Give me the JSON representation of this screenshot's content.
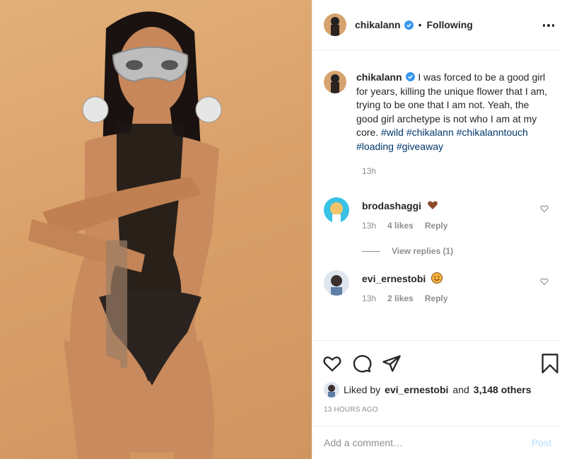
{
  "post": {
    "author": "chikalann",
    "follow_sep": "•",
    "follow_status": "Following",
    "caption_text": "I was forced to be a good girl for years, killing the unique flower that I am, trying to be one that I am not. Yeah, the good girl archetype is not who I am at my core.",
    "hashtags": [
      "#wild",
      "#chikalann",
      "#chikalanntouch",
      "#loading",
      "#giveaway"
    ],
    "caption_time": "13h",
    "comments": [
      {
        "user": "brodashaggi",
        "emoji": "brown-heart",
        "time": "13h",
        "likes": "4 likes",
        "reply": "Reply",
        "view_replies": "View replies (1)"
      },
      {
        "user": "evi_ernestobi",
        "emoji": "smiling-face",
        "time": "13h",
        "likes": "2 likes",
        "reply": "Reply"
      }
    ],
    "liked_by_prefix": "Liked by",
    "liked_by_user": "evi_ernestobi",
    "liked_by_and": "and",
    "liked_by_others": "3,148 others",
    "time_ago": "13 HOURS AGO",
    "add_comment_placeholder": "Add a comment…",
    "post_button": "Post"
  },
  "icons": {
    "more": "more-dots-icon",
    "like": "heart-icon",
    "comment": "comment-bubble-icon",
    "share": "paper-plane-icon",
    "save": "bookmark-icon",
    "verified": "verified-badge-icon"
  },
  "colors": {
    "verified": "#3897f0",
    "hashtag": "#00376b",
    "muted": "#8e8e8e",
    "post_disabled": "#b2dffc",
    "photo_bg": "#d9a06a"
  }
}
